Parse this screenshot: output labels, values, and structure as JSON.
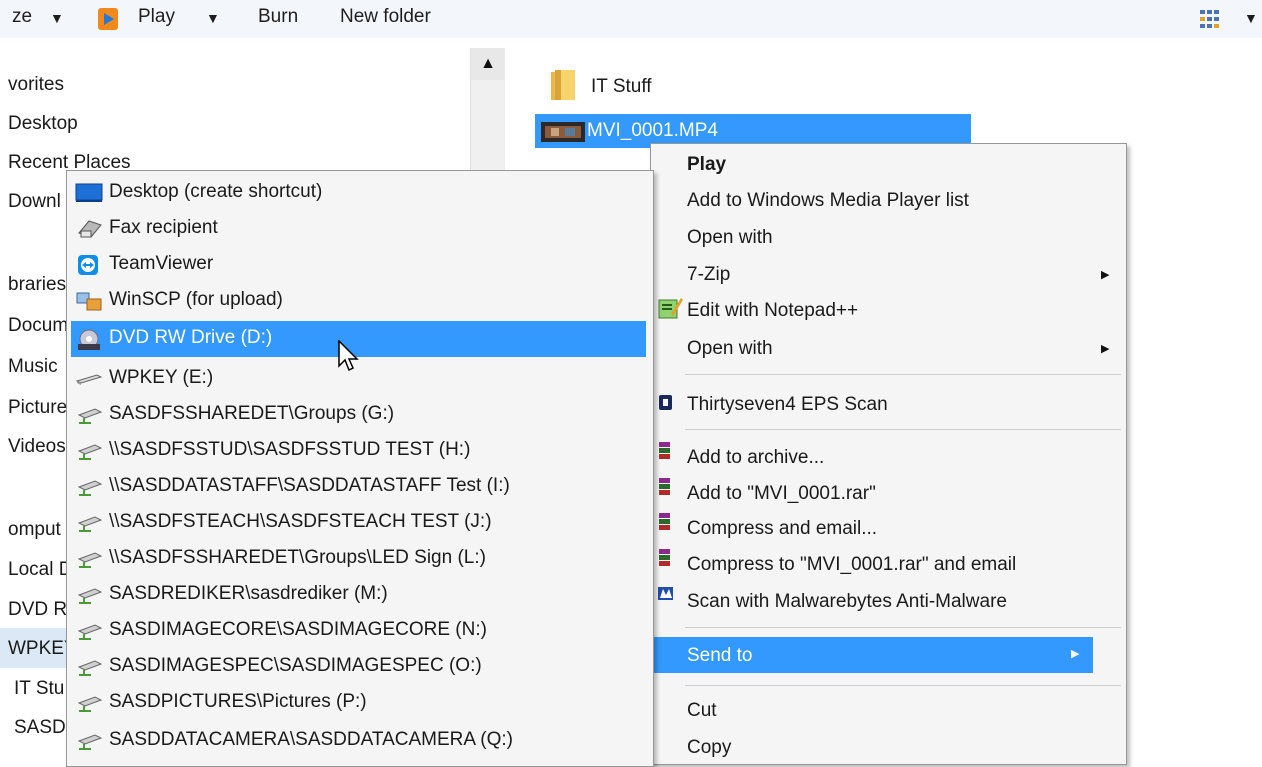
{
  "toolbar": {
    "organize": "ze",
    "play": "Play",
    "burn": "Burn",
    "new_folder": "New folder"
  },
  "nav": {
    "items": [
      "vorites",
      "Desktop",
      "Recent Places",
      "Downl",
      "braries",
      "Docum",
      "Music",
      "Picture",
      "Videos",
      "omput",
      "Local D",
      "DVD R",
      "WPKEY",
      "IT Stu",
      "SASDF"
    ]
  },
  "files": {
    "folder_name": "IT Stuff",
    "selected_file": "MVI_0001.MP4"
  },
  "context_menu": {
    "items": [
      "Play",
      "Add to Windows Media Player list",
      "Open with",
      "7-Zip",
      "Edit with Notepad++",
      "Open with",
      "Thirtyseven4 EPS Scan",
      "Add to archive...",
      "Add to \"MVI_0001.rar\"",
      "Compress and email...",
      "Compress to \"MVI_0001.rar\" and email",
      "Scan with Malwarebytes Anti-Malware",
      "Send to",
      "Cut",
      "Copy"
    ],
    "highlight_color": "#3399ff"
  },
  "send_to_menu": {
    "items": [
      "Desktop (create shortcut)",
      "Fax recipient",
      "TeamViewer",
      "WinSCP (for upload)",
      "DVD RW Drive (D:)",
      "WPKEY (E:)",
      "SASDFSSHAREDET\\Groups (G:)",
      "\\\\SASDFSSTUD\\SASDFSSTUD TEST (H:)",
      "\\\\SASDDATASTAFF\\SASDDATASTAFF Test (I:)",
      "\\\\SASDFSTEACH\\SASDFSTEACH TEST (J:)",
      "\\\\SASDFSSHAREDET\\Groups\\LED Sign (L:)",
      "SASDREDIKER\\sasdrediker (M:)",
      "SASDIMAGECORE\\SASDIMAGECORE (N:)",
      "SASDIMAGESPEC\\SASDIMAGESPEC (O:)",
      "SASDPICTURES\\Pictures (P:)",
      "SASDDATACAMERA\\SASDDATACAMERA (Q:)"
    ],
    "icons": [
      "desktop-icon",
      "fax-icon",
      "teamviewer-icon",
      "winscp-icon",
      "dvd-drive-icon",
      "usb-drive-icon",
      "network-drive-icon",
      "network-drive-icon",
      "network-drive-icon",
      "network-drive-icon",
      "network-drive-icon",
      "network-drive-icon",
      "network-drive-icon",
      "network-drive-icon",
      "network-drive-icon",
      "network-drive-icon"
    ]
  }
}
